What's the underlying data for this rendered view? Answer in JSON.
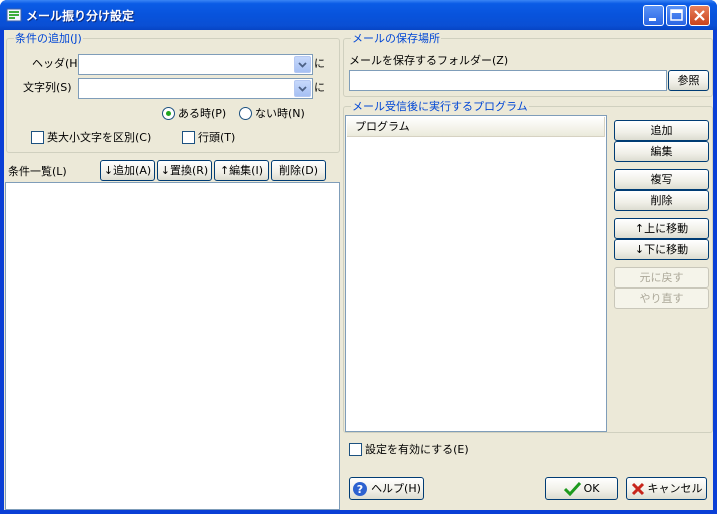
{
  "window": {
    "title": "メール振り分け設定"
  },
  "conditions_group": {
    "legend": "条件の追加(J)",
    "header_label": "ヘッダ(H)",
    "header_value": "",
    "header_suffix": "に",
    "string_label": "文字列(S)",
    "string_value": "",
    "string_suffix": "に",
    "radio_present": "ある時(P)",
    "radio_absent": "ない時(N)",
    "selected_radio": "ある時(P)",
    "case_sensitive": "英大小文字を区別(C)",
    "line_start": "行頭(T)"
  },
  "condition_list": {
    "label": "条件一覧(L)",
    "add_button": "↓追加(A)",
    "replace_button": "↓置換(R)",
    "edit_button": "↑編集(I)",
    "delete_button": "削除(D)",
    "items": []
  },
  "save_location": {
    "legend": "メールの保存場所",
    "folder_label": "メールを保存するフォルダー(Z)",
    "folder_value": "",
    "browse_button": "参照"
  },
  "programs": {
    "legend": "メール受信後に実行するプログラム",
    "column_header": "プログラム",
    "items": [],
    "add_button": "追加",
    "edit_button": "編集",
    "copy_button": "複写",
    "delete_button": "削除",
    "move_up_button": "↑上に移動",
    "move_down_button": "↓下に移動",
    "undo_button": "元に戻す",
    "redo_button": "やり直す"
  },
  "enable_setting": "設定を有効にする(E)",
  "footer": {
    "help_button": "ヘルプ(H)",
    "ok_button": "OK",
    "cancel_button": "キャンセル"
  },
  "colors": {
    "titlebar": "#0853dc",
    "group_legend": "#0046d5",
    "dialog_face": "#ece9d8"
  }
}
